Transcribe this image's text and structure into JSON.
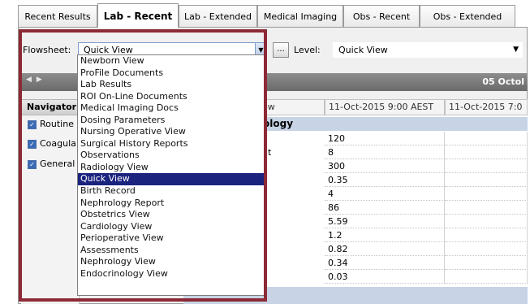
{
  "tabs": [
    {
      "label": "Recent Results"
    },
    {
      "label": "Lab - Recent"
    },
    {
      "label": "Lab - Extended"
    },
    {
      "label": "Medical Imaging"
    },
    {
      "label": "Obs - Recent"
    },
    {
      "label": "Obs - Extended"
    }
  ],
  "toolbar": {
    "flowsheet_label": "Flowsheet:",
    "flowsheet_value": "Quick View",
    "ellipsis_label": "...",
    "level_label": "Level:",
    "level_value": "Quick View"
  },
  "date_bar": {
    "text": "05 Octol"
  },
  "navigator": {
    "header": "Navigator",
    "items": [
      {
        "label": "Routine"
      },
      {
        "label": "Coagula"
      },
      {
        "label": "General"
      }
    ]
  },
  "grid": {
    "columns": [
      "ew",
      "11-Oct-2015 9:00 AEST",
      "11-Oct-2015 7:0"
    ],
    "section": "ology",
    "row_fragment": "t",
    "values": [
      "120",
      "8",
      "300",
      "0.35",
      "4",
      "86",
      "5.59",
      "1.2",
      "0.82",
      "0.34",
      "0.03"
    ]
  },
  "dropdown": {
    "selected": "Quick View",
    "items": [
      "Newborn View",
      "ProFile Documents",
      "Lab Results",
      "ROI On-Line Documents",
      "Medical Imaging Docs",
      "Dosing Parameters",
      "Nursing Operative View",
      "Surgical History Reports",
      "Observations",
      "Radiology View",
      "Quick View",
      "Birth Record",
      "Nephrology Report",
      "Obstetrics View",
      "Cardiology View",
      "Perioperative View",
      "Assessments",
      "Nephrology View",
      "Endocrinology View"
    ]
  }
}
